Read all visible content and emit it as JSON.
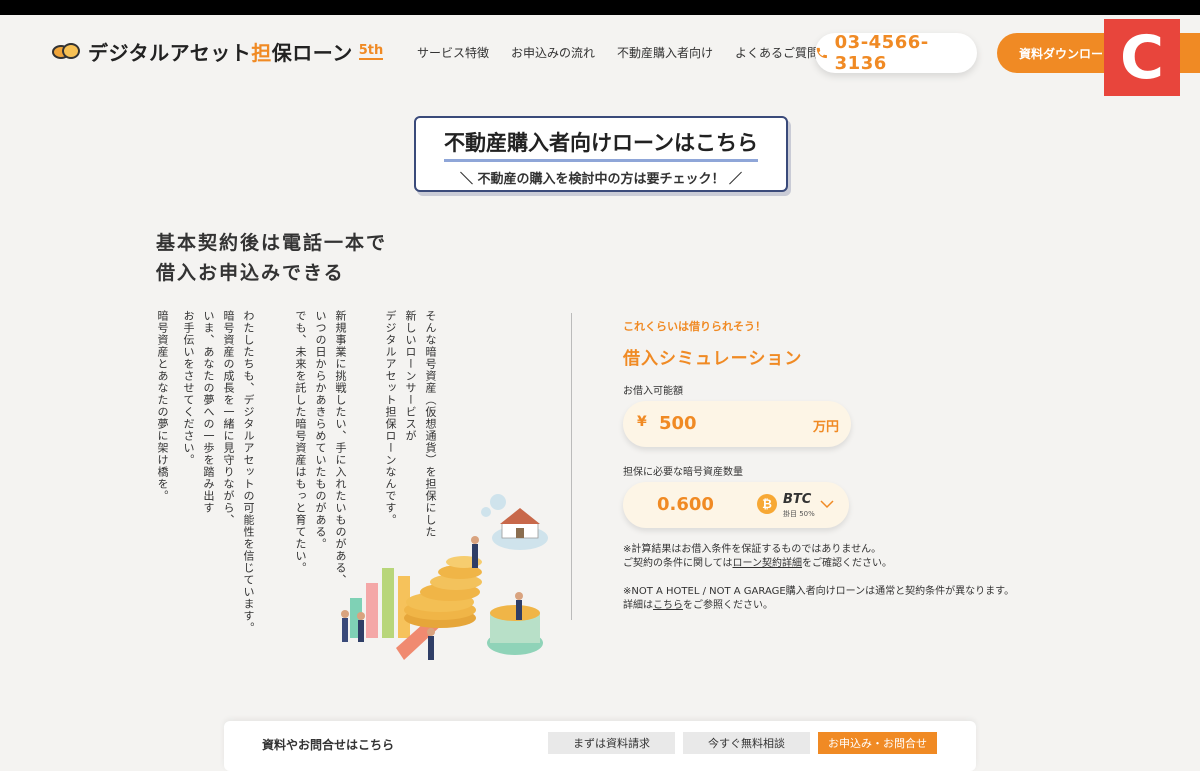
{
  "header": {
    "logo": {
      "text_before": "デジタルアセット",
      "accent": "担",
      "text_after": "保ローン",
      "badge": "5th"
    },
    "nav": [
      "サービス特徴",
      "お申込みの流れ",
      "不動産購入者向け",
      "よくあるご質問"
    ],
    "phone": "03-4566-3136",
    "download_label": "資料ダウンロード",
    "overlay_badge": "C"
  },
  "banner": {
    "title": "不動産購入者向けローンはこちら",
    "subtitle": "＼ 不動産の購入を検討中の方は要チェック！ ／"
  },
  "headline": {
    "line1": "基本契約後は電話一本で",
    "line2": "借入お申込みできる"
  },
  "story": {
    "p1": [
      "そんな暗号資産（仮想通貨）を担保にした",
      "新しいローンサービスが",
      "デジタルアセット担保ローンなんです。"
    ],
    "p2": [
      "新規事業に挑戦したい、手に入れたいものがある、",
      "いつの日からかあきらめていたものがある。",
      "でも、未来を託した暗号資産はもっと育てたい。"
    ],
    "p3": [
      "わたしたちも、デジタルアセットの可能性を信じています。",
      "暗号資産の成長を一緒に見守りながら、",
      "いま、あなたの夢への一歩を踏み出す",
      "お手伝いをさせてください。"
    ],
    "p4": [
      "暗号資産とあなたの夢に架け橋を。"
    ]
  },
  "simulation": {
    "kicker": "これくらいは借りられそう！",
    "title": "借入シミュレーション",
    "loan_label": "お借入可能額",
    "currency_symbol": "¥",
    "loan_amount": "500",
    "loan_unit": "万円",
    "collateral_label": "担保に必要な暗号資産数量",
    "collateral_amount": "0.600",
    "coin_symbol": "₿",
    "coin_name": "BTC",
    "coin_note": "掛目 50%",
    "note1": "※計算結果はお借入条件を保証するものではありません。",
    "note2_before": "ご契約の条件に関しては",
    "note2_link": "ローン契約詳細",
    "note2_after": "をご確認ください。",
    "note3": "※NOT A HOTEL / NOT A GARAGE購入者向けローンは通常と契約条件が異なります。",
    "note4_before": "詳細は",
    "note4_link": "こちら",
    "note4_after": "をご参照ください。"
  },
  "bottom_bar": {
    "label": "資料やお問合せはこちら",
    "btn_docs": "まずは資料請求",
    "btn_consult": "今すぐ無料相談",
    "btn_apply": "お申込み・お問合せ"
  },
  "colors": {
    "accent": "#f08a24",
    "badge_red": "#e8453c",
    "banner_border": "#3a4a7a"
  }
}
